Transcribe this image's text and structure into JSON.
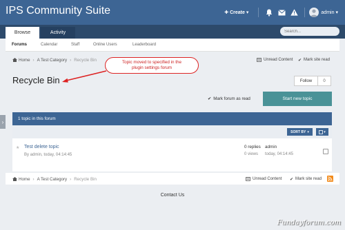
{
  "header": {
    "site_title": "IPS Community Suite",
    "create_label": "Create",
    "user_name": "admin",
    "icons": [
      "bell-icon",
      "envelope-icon",
      "warning-icon"
    ]
  },
  "nav": {
    "tabs": [
      {
        "label": "Browse",
        "active": true
      },
      {
        "label": "Activity",
        "active": false
      }
    ],
    "search_placeholder": "Search..."
  },
  "subnav": [
    {
      "label": "Forums",
      "active": true
    },
    {
      "label": "Calendar",
      "active": false
    },
    {
      "label": "Staff",
      "active": false
    },
    {
      "label": "Online Users",
      "active": false
    },
    {
      "label": "Leaderboard",
      "active": false
    }
  ],
  "breadcrumb": {
    "items": [
      "Home",
      "A Test Category",
      "Recycle Bin"
    ],
    "unread_label": "Unread Content",
    "mark_read_label": "Mark site read"
  },
  "annotation": {
    "line1": "Topic moved to specified in the",
    "line2": "plugin settings forum"
  },
  "page": {
    "title": "Recycle Bin",
    "follow_label": "Follow",
    "follow_count": "0",
    "mark_forum_read": "Mark forum as read",
    "start_topic": "Start new topic"
  },
  "forum": {
    "header": "1 topic in this forum",
    "sort_label": "SORT BY",
    "topics": [
      {
        "title": "Test delete topic",
        "meta": "By admin, today, 04:14:45",
        "replies": "0 replies",
        "views": "0 views",
        "last_user": "admin",
        "last_time": "today, 04:14:45"
      }
    ]
  },
  "footer": {
    "contact": "Contact Us"
  },
  "watermark": "Fundayforum.com",
  "colors": {
    "header": "#3d6594",
    "navbar": "#2d4a6b",
    "accent_button": "#4a9297",
    "annotation": "#dd2222",
    "rss": "#f28a1a"
  }
}
